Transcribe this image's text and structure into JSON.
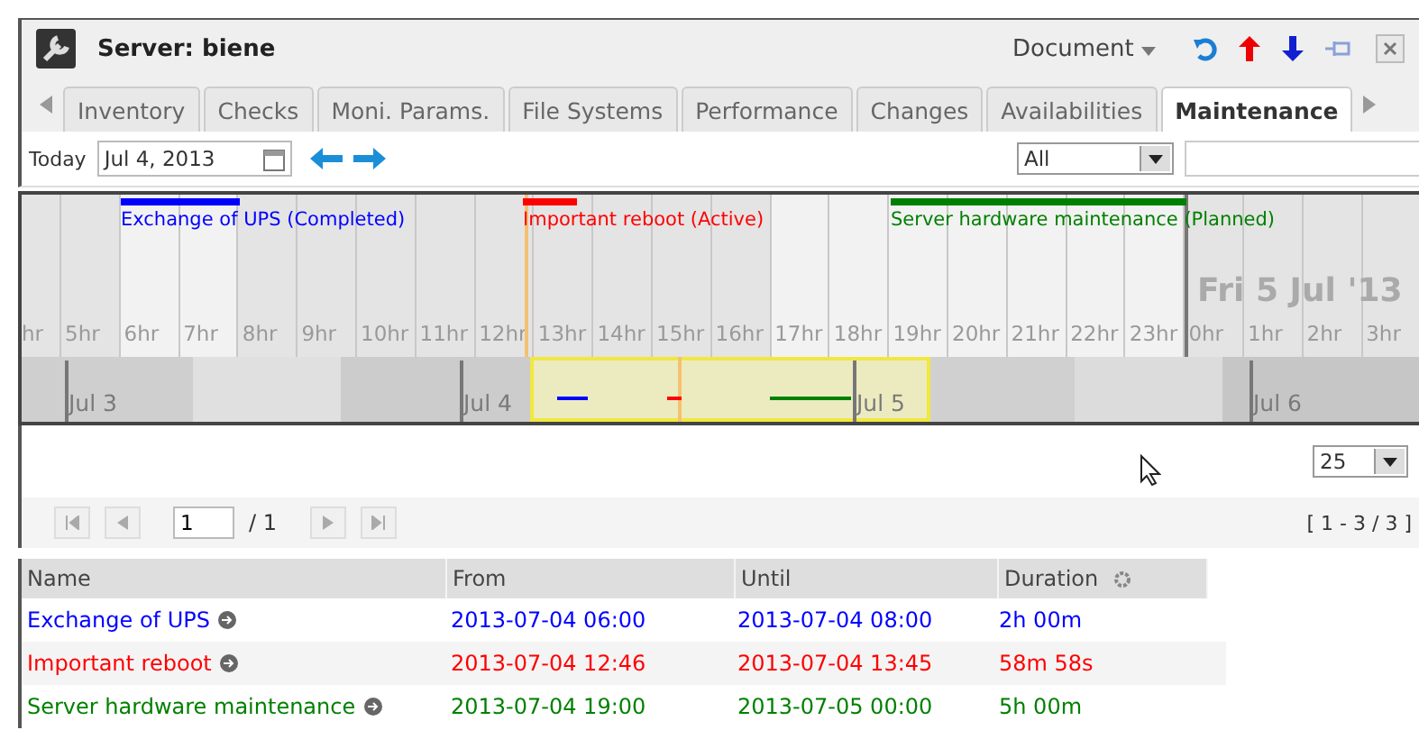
{
  "window": {
    "title": "Server: biene",
    "menu": "Document"
  },
  "tabs": [
    {
      "label": "Inventory",
      "selected": false
    },
    {
      "label": "Checks",
      "selected": false
    },
    {
      "label": "Moni. Params.",
      "selected": false
    },
    {
      "label": "File Systems",
      "selected": false
    },
    {
      "label": "Performance",
      "selected": false
    },
    {
      "label": "Changes",
      "selected": false
    },
    {
      "label": "Availabilities",
      "selected": false
    },
    {
      "label": "Maintenance",
      "selected": true
    }
  ],
  "toolbar": {
    "today": "Today",
    "date": "Jul 4, 2013",
    "filter": "All"
  },
  "timeline": {
    "hours": [
      "hr",
      "5hr",
      "6hr",
      "7hr",
      "8hr",
      "9hr",
      "10hr",
      "11hr",
      "12hr",
      "13hr",
      "14hr",
      "15hr",
      "16hr",
      "17hr",
      "18hr",
      "19hr",
      "20hr",
      "21hr",
      "22hr",
      "23hr",
      "0hr",
      "1hr",
      "2hr",
      "3hr"
    ],
    "day_title": "Fri 5 Jul '13",
    "days": [
      "Jul 3",
      "Jul 4",
      "Jul 5",
      "Jul 6"
    ],
    "events": [
      {
        "label": "Exchange of UPS (Completed)",
        "color": "#0000ff"
      },
      {
        "label": "Important reboot (Active)",
        "color": "#ff0000"
      },
      {
        "label": "Server hardware maintenance (Planned)",
        "color": "#008000"
      }
    ]
  },
  "page_size": "25",
  "pager": {
    "page": "1",
    "total": "/ 1",
    "range": "[ 1 - 3 / 3 ]"
  },
  "table": {
    "columns": [
      "Name",
      "From",
      "Until",
      "Duration"
    ],
    "rows": [
      {
        "name": "Exchange of UPS",
        "from": "2013-07-04 06:00",
        "until": "2013-07-04 08:00",
        "duration": "2h 00m",
        "color": "#0000ff"
      },
      {
        "name": "Important reboot",
        "from": "2013-07-04 12:46",
        "until": "2013-07-04 13:45",
        "duration": "58m 58s",
        "color": "#ff0000"
      },
      {
        "name": "Server hardware maintenance",
        "from": "2013-07-04 19:00",
        "until": "2013-07-05 00:00",
        "duration": "5h 00m",
        "color": "#008000"
      }
    ]
  }
}
